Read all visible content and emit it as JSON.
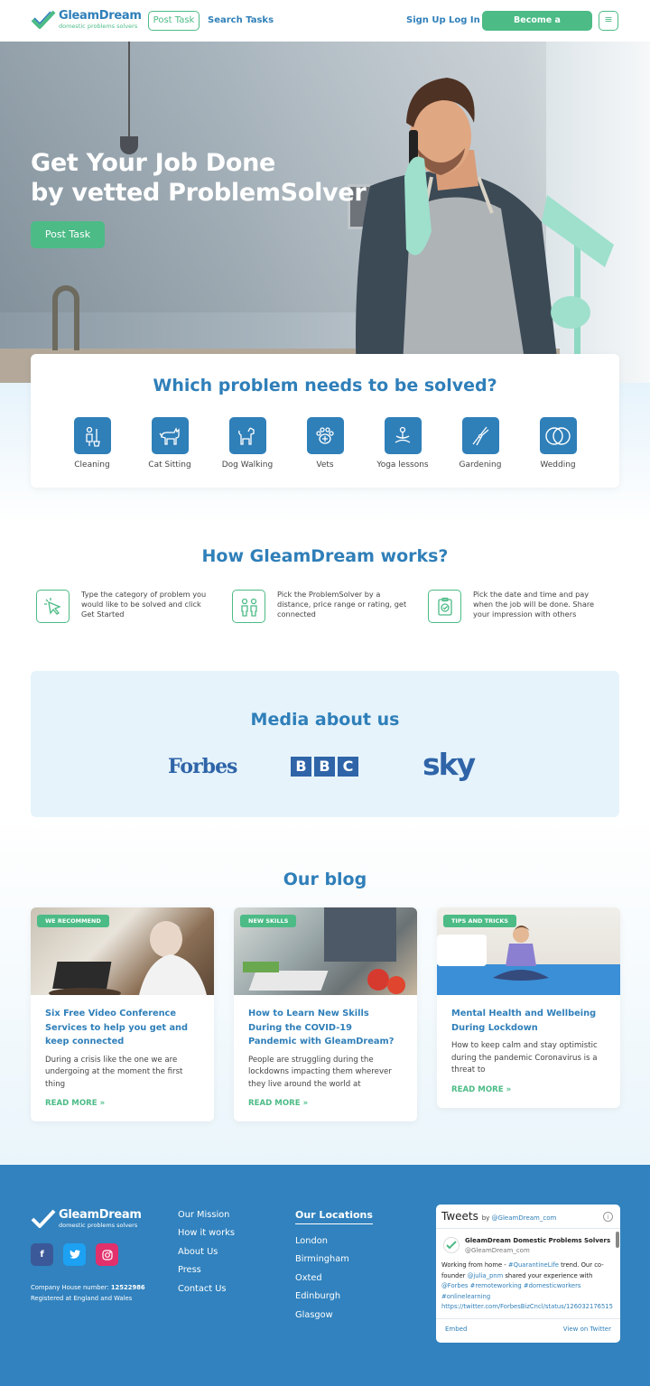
{
  "brand": {
    "name": "GleamDream",
    "tagline": "domestic problems solvers"
  },
  "nav": {
    "post_task": "Post Task",
    "search_tasks": "Search Tasks",
    "sign_up": "Sign Up",
    "log_in": "Log In",
    "become": "Become a ProblemSolver",
    "menu_icon": "hamburger-icon"
  },
  "hero": {
    "headline_line1": "Get Your Job Done",
    "headline_line2": "by vetted ProblemSolver",
    "cta": "Post Task"
  },
  "categories": {
    "title": "Which problem needs to be solved?",
    "items": [
      {
        "label": "Cleaning",
        "icon": "cleaning-icon"
      },
      {
        "label": "Cat Sitting",
        "icon": "cat-icon"
      },
      {
        "label": "Dog Walking",
        "icon": "dog-icon"
      },
      {
        "label": "Vets",
        "icon": "paw-vet-icon"
      },
      {
        "label": "Yoga lessons",
        "icon": "yoga-icon"
      },
      {
        "label": "Gardening",
        "icon": "pruning-shears-icon"
      },
      {
        "label": "Wedding",
        "icon": "rings-icon"
      }
    ]
  },
  "how": {
    "title": "How GleamDream works?",
    "steps": [
      {
        "icon": "cursor-click-icon",
        "text": "Type the category of problem you would like to be solved and click Get Started"
      },
      {
        "icon": "people-icon",
        "text": "Pick the ProblemSolver by a distance, price range or rating, get connected"
      },
      {
        "icon": "clipboard-icon",
        "text": "Pick the date and time and pay when the job will be done. Share your impression with others"
      }
    ]
  },
  "media": {
    "title": "Media about us",
    "logos": [
      "Forbes",
      "BBC",
      "sky"
    ]
  },
  "blog": {
    "title": "Our blog",
    "posts": [
      {
        "tag": "WE RECOMMEND",
        "title": "Six Free Video Conference Services to help you get and keep connected",
        "excerpt": "During a crisis like the one we are undergoing at the moment the first thing",
        "more": "READ MORE »"
      },
      {
        "tag": "NEW SKILLS",
        "title": "How to Learn New Skills During the COVID-19 Pandemic with GleamDream?",
        "excerpt": "People are struggling during the lockdowns impacting them wherever they live around the world at",
        "more": "READ MORE »"
      },
      {
        "tag": "TIPS AND TRICKS",
        "title": "Mental Health and Wellbeing During Lockdown",
        "excerpt": "How to keep calm and stay optimistic during the pandemic Coronavirus is a threat to",
        "more": "READ MORE »"
      }
    ]
  },
  "footer": {
    "company_label": "Company House number:",
    "company_number": "12522986",
    "registered": "Registered at England and Wales",
    "social": [
      {
        "icon": "facebook-icon",
        "color": "#3b5998"
      },
      {
        "icon": "twitter-icon",
        "color": "#1da1f2"
      },
      {
        "icon": "instagram-icon",
        "color": "#e1306c"
      }
    ],
    "links": [
      "Our Mission",
      "How it works",
      "About Us",
      "Press",
      "Contact Us"
    ],
    "locations_title": "Our Locations",
    "locations": [
      "London",
      "Birmingham",
      "Oxted",
      "Edinburgh",
      "Glasgow"
    ]
  },
  "tweets": {
    "title": "Tweets",
    "by": "by",
    "by_handle": "@GleamDream_com",
    "author_name": "GleamDream Domestic Problems Solvers",
    "author_handle": "@GleamDream_com",
    "body_1": "Working from home - ",
    "body_hashtag1": "#QuarantineLife",
    "body_2": " trend. Our co-founder ",
    "body_mention1": "@julia_pnm",
    "body_3": " shared your experience with ",
    "body_mention2": "@Forbes",
    "body_4": " ",
    "body_hashtags2": "#remoteworking #domesticworkers #onlinelearning",
    "body_link": "https://twitter.com/ForbesBizCncl/status/126032176515",
    "embed": "Embed",
    "view": "View on Twitter"
  },
  "colors": {
    "primary": "#2f7fb9",
    "accent": "#4cbb86",
    "footer": "#3182be",
    "light": "#e6f3fb"
  }
}
